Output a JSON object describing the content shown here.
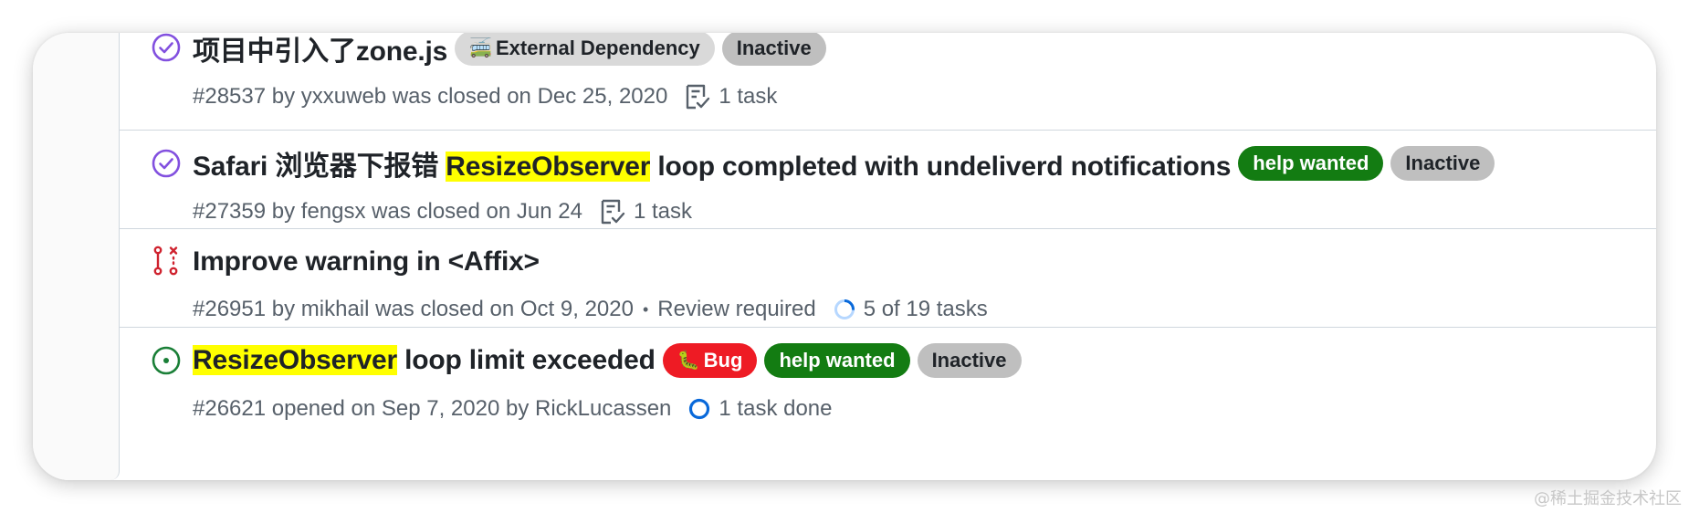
{
  "colors": {
    "closed_icon": "#8250df",
    "draft_icon": "#cf222e",
    "open_icon": "#1a7f37",
    "highlight": "#ffff00",
    "label_inactive_bg": "#bfbfbf",
    "label_help_bg": "#137c12",
    "label_bug_bg": "#ee1b24",
    "label_external_bg": "#d9d9d9"
  },
  "issues": [
    {
      "status_icon": "closed-check-circle-icon",
      "title_parts": [
        "项目中引入了zone.js"
      ],
      "labels": [
        {
          "text": "External Dependency",
          "icon": "bus-icon",
          "glyph": "🚎"
        },
        {
          "text": "Inactive"
        }
      ],
      "meta": "#28537 by yxxuweb was closed on Dec 25, 2020",
      "task": "1 task",
      "task_icon": "task-list-icon"
    },
    {
      "status_icon": "closed-check-circle-icon",
      "title_parts": [
        "Safari 浏览器下报错 ",
        "ResizeObserver",
        " loop completed with undeliverd notifications"
      ],
      "labels": [
        {
          "text": "help wanted"
        },
        {
          "text": "Inactive"
        }
      ],
      "meta": "#27359 by fengsx was closed on Jun 24",
      "task": "1 task",
      "task_icon": "task-list-icon"
    },
    {
      "status_icon": "closed-pull-request-icon",
      "title_parts": [
        "Improve warning in <Affix>"
      ],
      "labels": [],
      "meta": "#26951 by mikhail was closed on Oct 9, 2020",
      "separator": "•",
      "review": "Review required",
      "task": "5 of 19 tasks",
      "task_icon": "task-progress-icon",
      "task_progress": 0.26
    },
    {
      "status_icon": "open-issue-icon",
      "title_parts": [
        "ResizeObserver",
        " loop limit exceeded"
      ],
      "labels": [
        {
          "text": "Bug",
          "icon": "bug-icon",
          "glyph": "🐛"
        },
        {
          "text": "help wanted"
        },
        {
          "text": "Inactive"
        }
      ],
      "meta": "#26621 opened on Sep 7, 2020 by RickLucassen",
      "task": "1 task done",
      "task_icon": "task-done-circle-icon"
    }
  ],
  "watermark": "@稀土掘金技术社区"
}
